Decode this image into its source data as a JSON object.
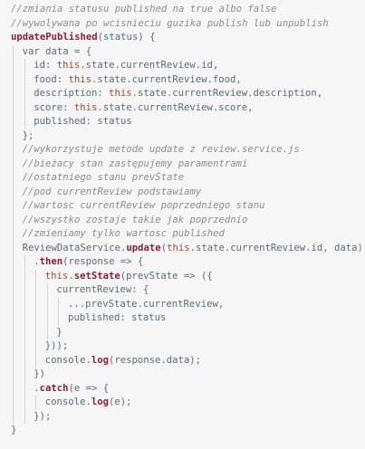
{
  "editor": {
    "background": "#f6f6f6",
    "colors": {
      "comment": "#8d8d8d",
      "plain": "#5c6b76",
      "function": "#8a1f3d",
      "keyword": "#a14d2a",
      "property": "#7a3c1e"
    },
    "lines": [
      {
        "indent": 0,
        "tokens": [
          {
            "t": "//zmiania statusu published na true albo false",
            "c": "comment"
          }
        ]
      },
      {
        "indent": 0,
        "tokens": [
          {
            "t": "//wywolywana po wcisnieciu guzika publish lub unpublish",
            "c": "comment"
          }
        ]
      },
      {
        "indent": 0,
        "tokens": [
          {
            "t": "updatePublished",
            "c": "fn"
          },
          {
            "t": "(status) {",
            "c": "plain"
          }
        ]
      },
      {
        "indent": 1,
        "tokens": [
          {
            "t": "var",
            "c": "plain"
          },
          {
            "t": " data = {",
            "c": "plain"
          }
        ]
      },
      {
        "indent": 2,
        "tokens": [
          {
            "t": "id: ",
            "c": "plain"
          },
          {
            "t": "this",
            "c": "kw"
          },
          {
            "t": ".state.currentReview.id,",
            "c": "plain"
          }
        ]
      },
      {
        "indent": 2,
        "tokens": [
          {
            "t": "food: ",
            "c": "plain"
          },
          {
            "t": "this",
            "c": "kw"
          },
          {
            "t": ".state.currentReview.food,",
            "c": "plain"
          }
        ]
      },
      {
        "indent": 2,
        "tokens": [
          {
            "t": "description: ",
            "c": "plain"
          },
          {
            "t": "this",
            "c": "kw"
          },
          {
            "t": ".state.currentReview.description,",
            "c": "plain"
          }
        ]
      },
      {
        "indent": 2,
        "tokens": [
          {
            "t": "score: ",
            "c": "plain"
          },
          {
            "t": "this",
            "c": "kw"
          },
          {
            "t": ".state.currentReview.score,",
            "c": "plain"
          }
        ]
      },
      {
        "indent": 2,
        "tokens": [
          {
            "t": "published: status",
            "c": "plain"
          }
        ]
      },
      {
        "indent": 1,
        "tokens": [
          {
            "t": "};",
            "c": "plain"
          }
        ]
      },
      {
        "indent": 1,
        "tokens": [
          {
            "t": "//wykorzystuje metode update z review.service.js",
            "c": "comment"
          }
        ]
      },
      {
        "indent": 1,
        "tokens": [
          {
            "t": "//bieżacy stan zastępujemy paramentrami",
            "c": "comment"
          }
        ]
      },
      {
        "indent": 1,
        "tokens": [
          {
            "t": "//ostatniego stanu prevState",
            "c": "comment"
          }
        ]
      },
      {
        "indent": 1,
        "tokens": [
          {
            "t": "//pod currentReview podstawiamy",
            "c": "comment"
          }
        ]
      },
      {
        "indent": 1,
        "tokens": [
          {
            "t": "//wartosc currentReview poprzedniego stanu",
            "c": "comment"
          }
        ]
      },
      {
        "indent": 1,
        "tokens": [
          {
            "t": "//wszystko zostaje takie jak poprzednio",
            "c": "comment"
          }
        ]
      },
      {
        "indent": 1,
        "tokens": [
          {
            "t": "//zmieniamy tylko wartosc published",
            "c": "comment"
          }
        ]
      },
      {
        "indent": 1,
        "tokens": [
          {
            "t": "ReviewDataService.",
            "c": "plain"
          },
          {
            "t": "update",
            "c": "fn"
          },
          {
            "t": "(",
            "c": "plain"
          },
          {
            "t": "this",
            "c": "kw"
          },
          {
            "t": ".state.currentReview.id, data)",
            "c": "plain"
          }
        ]
      },
      {
        "indent": 2,
        "tokens": [
          {
            "t": ".",
            "c": "plain"
          },
          {
            "t": "then",
            "c": "fn"
          },
          {
            "t": "(response => {",
            "c": "plain"
          }
        ]
      },
      {
        "indent": 3,
        "tokens": [
          {
            "t": "this",
            "c": "kw"
          },
          {
            "t": ".",
            "c": "plain"
          },
          {
            "t": "setState",
            "c": "fn"
          },
          {
            "t": "(prevState => ({",
            "c": "plain"
          }
        ]
      },
      {
        "indent": 4,
        "tokens": [
          {
            "t": "currentReview: {",
            "c": "plain"
          }
        ]
      },
      {
        "indent": 5,
        "tokens": [
          {
            "t": "...prevState.currentReview,",
            "c": "plain"
          }
        ]
      },
      {
        "indent": 5,
        "tokens": [
          {
            "t": "published: status",
            "c": "plain"
          }
        ]
      },
      {
        "indent": 4,
        "tokens": [
          {
            "t": "}",
            "c": "plain"
          }
        ]
      },
      {
        "indent": 3,
        "tokens": [
          {
            "t": "}));",
            "c": "plain"
          }
        ]
      },
      {
        "indent": 3,
        "tokens": [
          {
            "t": "console.",
            "c": "plain"
          },
          {
            "t": "log",
            "c": "fn"
          },
          {
            "t": "(response.data);",
            "c": "plain"
          }
        ]
      },
      {
        "indent": 2,
        "tokens": [
          {
            "t": "})",
            "c": "plain"
          }
        ]
      },
      {
        "indent": 2,
        "tokens": [
          {
            "t": ".",
            "c": "plain"
          },
          {
            "t": "catch",
            "c": "fn"
          },
          {
            "t": "(e => {",
            "c": "plain"
          }
        ]
      },
      {
        "indent": 3,
        "tokens": [
          {
            "t": "console.",
            "c": "plain"
          },
          {
            "t": "log",
            "c": "fn"
          },
          {
            "t": "(e);",
            "c": "plain"
          }
        ]
      },
      {
        "indent": 2,
        "tokens": [
          {
            "t": "});",
            "c": "plain"
          }
        ]
      },
      {
        "indent": 0,
        "tokens": [
          {
            "t": "}",
            "c": "plain"
          }
        ]
      }
    ]
  }
}
